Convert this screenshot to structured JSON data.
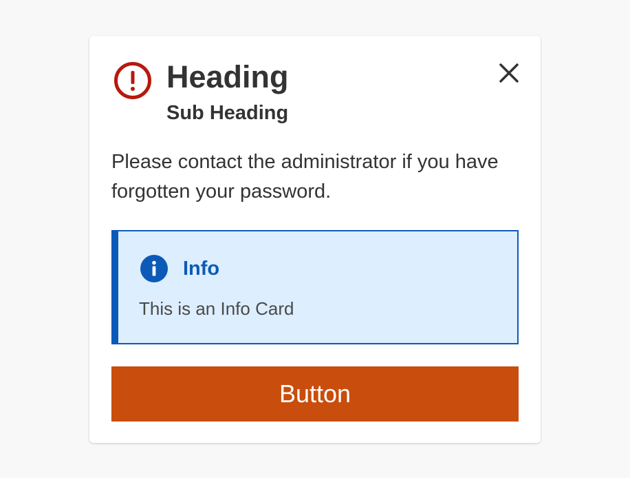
{
  "dialog": {
    "heading": "Heading",
    "subheading": "Sub Heading",
    "message": "Please contact the administrator if you have forgotten your password.",
    "alert_icon": "alert-circle-icon",
    "close_icon": "close-icon",
    "close_label": "Close"
  },
  "info_card": {
    "icon": "info-icon",
    "title": "Info",
    "text": "This is an Info Card"
  },
  "button": {
    "label": "Button"
  },
  "colors": {
    "background": "#f8f8f8",
    "surface": "#ffffff",
    "text": "#333333",
    "alert": "#b7190d",
    "info": "#0c5ab8",
    "info_background": "#ddeeff",
    "button": "#c94d0c",
    "button_text": "#ffffff"
  }
}
